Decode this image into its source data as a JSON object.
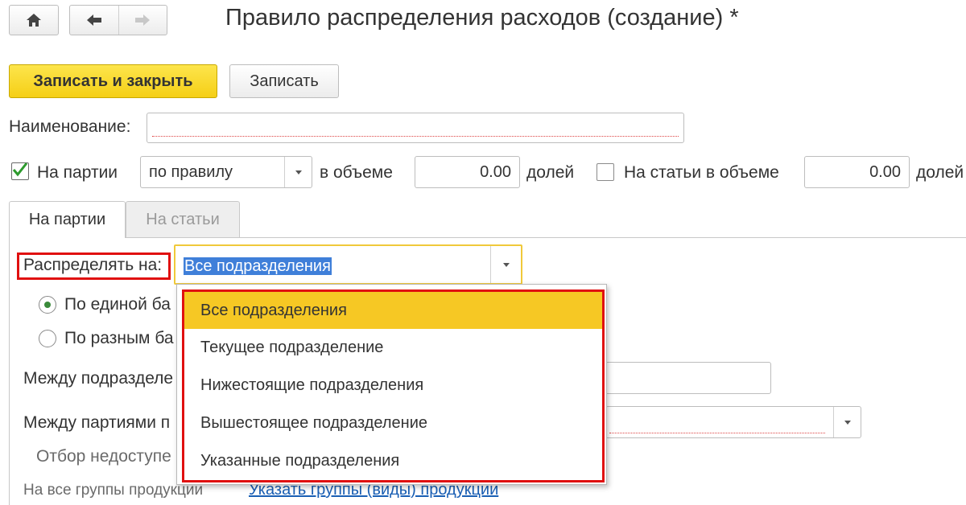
{
  "window": {
    "title": "Правило распределения расходов (создание) *"
  },
  "nav": {
    "home_icon": "home-icon",
    "back_icon": "arrow-left-icon",
    "forward_icon": "arrow-right-icon"
  },
  "toolbar": {
    "save_close_label": "Записать и закрыть",
    "save_label": "Записать",
    "accent_color": "#f5cf16"
  },
  "form": {
    "name_label": "Наименование:",
    "name_value": "",
    "batches_check_label": "На партии",
    "batches_checked": true,
    "batches_mode_value": "по правилу",
    "volume_label": "в объеме",
    "batches_share_value": "0.00",
    "shares_label": "долей",
    "items_check_label": "На статьи в объеме",
    "items_checked": false,
    "items_share_value": "0.00",
    "items_shares_label": "долей"
  },
  "tabs": [
    {
      "label": "На партии",
      "active": true
    },
    {
      "label": "На статьи",
      "active": false
    }
  ],
  "panel": {
    "distribute_label": "Распределять на:",
    "distribute_value": "Все подразделения",
    "radio_single_label": "По единой ба",
    "radio_single_selected": true,
    "radio_multi_label": "По разным ба",
    "radio_multi_selected": false,
    "between_depts_label": "Между подразделе",
    "between_batches_label": "Между партиями п",
    "filter_label": "Отбор недоступе",
    "all_groups_label": "На все группы продукции",
    "groups_link": "Указать группы (виды) продукции"
  },
  "dropdown": {
    "options": [
      "Все подразделения",
      "Текущее подразделение",
      "Нижестоящие подразделения",
      "Вышестоящее подразделение",
      "Указанные подразделения"
    ],
    "selected_index": 0,
    "highlight_color": "#f6c824",
    "annotation_color": "#e01010"
  }
}
